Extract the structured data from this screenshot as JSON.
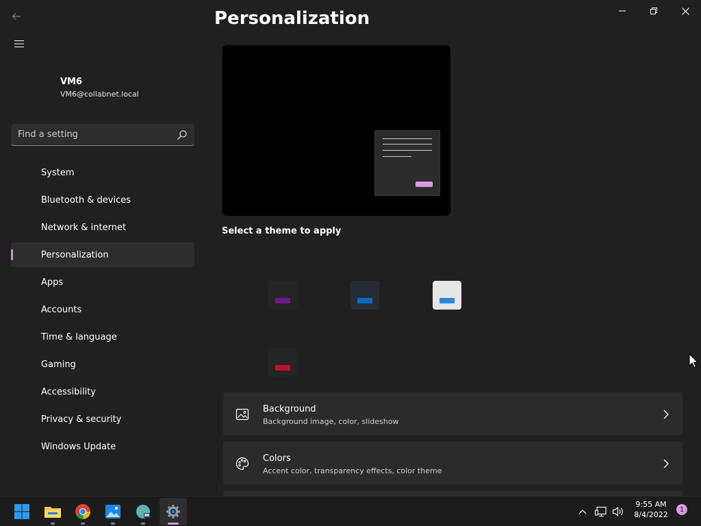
{
  "user": {
    "name": "VM6",
    "email": "VM6@collabnet.local"
  },
  "search": {
    "placeholder": "Find a setting",
    "value": ""
  },
  "nav": {
    "items": [
      {
        "label": "System",
        "active": false
      },
      {
        "label": "Bluetooth & devices",
        "active": false
      },
      {
        "label": "Network & internet",
        "active": false
      },
      {
        "label": "Personalization",
        "active": true
      },
      {
        "label": "Apps",
        "active": false
      },
      {
        "label": "Accounts",
        "active": false
      },
      {
        "label": "Time & language",
        "active": false
      },
      {
        "label": "Gaming",
        "active": false
      },
      {
        "label": "Accessibility",
        "active": false
      },
      {
        "label": "Privacy & security",
        "active": false
      },
      {
        "label": "Windows Update",
        "active": false
      }
    ]
  },
  "main": {
    "title": "Personalization",
    "theme_heading": "Select a theme to apply",
    "themes": [
      {
        "name": "theme-1",
        "accent": "#6b1a8c"
      },
      {
        "name": "theme-2",
        "accent": "#0f6cbd"
      },
      {
        "name": "theme-3",
        "accent": "#2b88d8"
      },
      {
        "name": "theme-4",
        "accent": "#c0102c"
      }
    ],
    "cards": [
      {
        "title": "Background",
        "subtitle": "Background image, color, slideshow",
        "icon": "image-icon"
      },
      {
        "title": "Colors",
        "subtitle": "Accent color, transparency effects, color theme",
        "icon": "palette-icon"
      }
    ]
  },
  "taskbar": {
    "apps": [
      "start",
      "file-explorer",
      "chrome",
      "photos",
      "network-app",
      "settings"
    ],
    "time": "9:55 AM",
    "date": "8/4/2022",
    "notifications": "1"
  },
  "colors": {
    "accent": "#d89ae0",
    "background": "#202020",
    "card": "#2b2b2b"
  }
}
